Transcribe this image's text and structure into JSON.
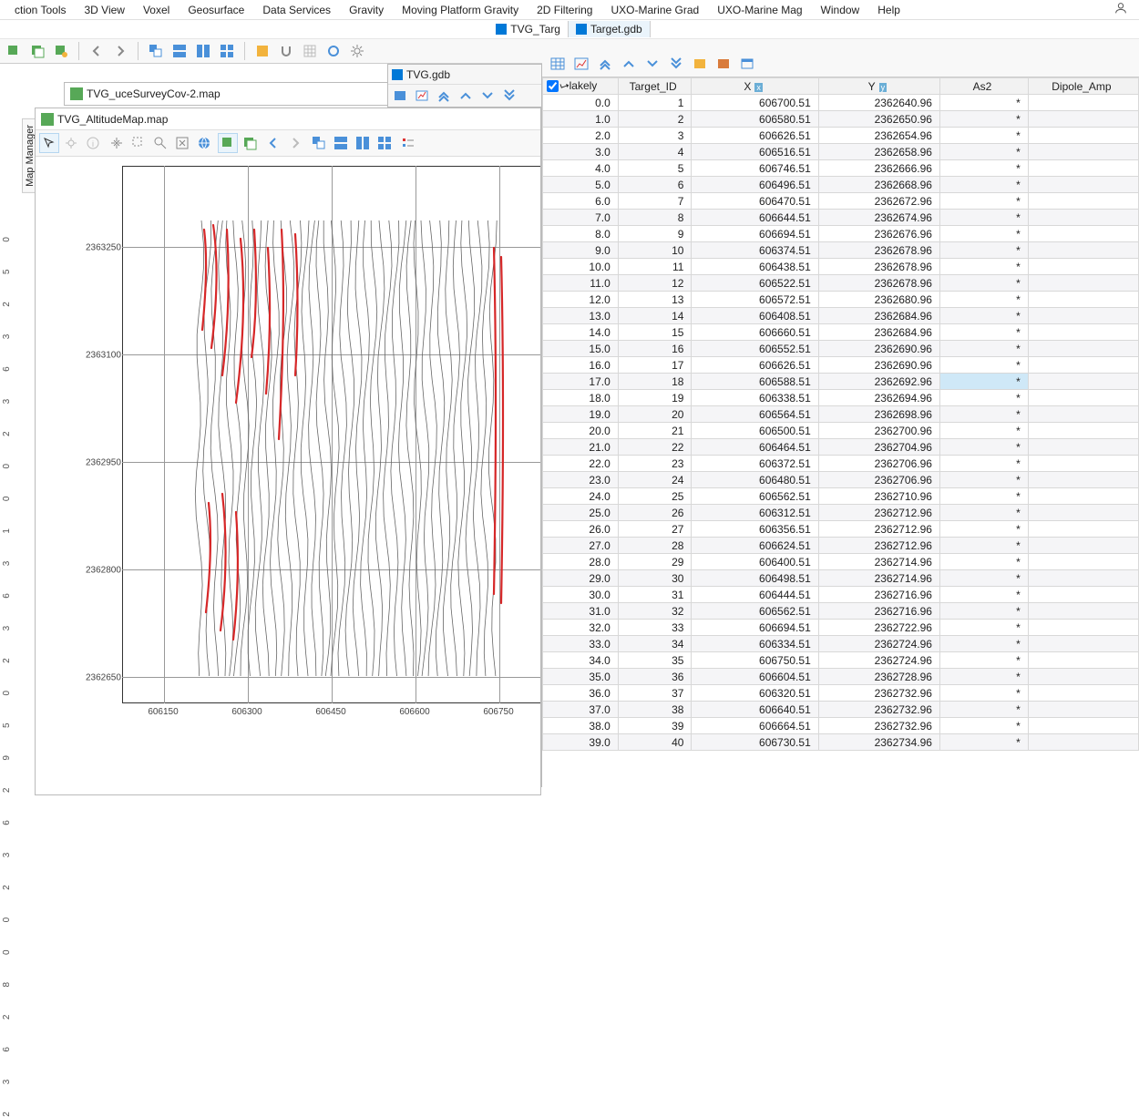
{
  "menu": [
    "ction Tools",
    "3D View",
    "Voxel",
    "Geosurface",
    "Data Services",
    "Gravity",
    "Moving Platform Gravity",
    "2D Filtering",
    "UXO-Marine Grad",
    "UXO-Marine Mag",
    "Window",
    "Help"
  ],
  "doc_tabs": {
    "left": "TVG_Targ",
    "right": "Target.gdb"
  },
  "map_tabs": {
    "background": "TVG_uceSurveyCov-2.map",
    "active": "TVG_AltitudeMap.map"
  },
  "side_panel_label": "Map Manager",
  "float_window_title": "TVG.gdb",
  "left_outer_axis_ticks": [
    "2362800",
    "2362950",
    "2363100",
    "2363250"
  ],
  "table": {
    "headers": {
      "col1": "lakely",
      "col2": "Target_ID",
      "col3": "X",
      "col4": "Y",
      "col5": "As2",
      "col6": "Dipole_Amp"
    },
    "selected_row_index": 17,
    "rows": [
      {
        "c1": "0.0",
        "c2": "1",
        "c3": "606700.51",
        "c4": "2362640.96",
        "c5": "*",
        "c6": ""
      },
      {
        "c1": "1.0",
        "c2": "2",
        "c3": "606580.51",
        "c4": "2362650.96",
        "c5": "*",
        "c6": ""
      },
      {
        "c1": "2.0",
        "c2": "3",
        "c3": "606626.51",
        "c4": "2362654.96",
        "c5": "*",
        "c6": ""
      },
      {
        "c1": "3.0",
        "c2": "4",
        "c3": "606516.51",
        "c4": "2362658.96",
        "c5": "*",
        "c6": ""
      },
      {
        "c1": "4.0",
        "c2": "5",
        "c3": "606746.51",
        "c4": "2362666.96",
        "c5": "*",
        "c6": ""
      },
      {
        "c1": "5.0",
        "c2": "6",
        "c3": "606496.51",
        "c4": "2362668.96",
        "c5": "*",
        "c6": ""
      },
      {
        "c1": "6.0",
        "c2": "7",
        "c3": "606470.51",
        "c4": "2362672.96",
        "c5": "*",
        "c6": ""
      },
      {
        "c1": "7.0",
        "c2": "8",
        "c3": "606644.51",
        "c4": "2362674.96",
        "c5": "*",
        "c6": ""
      },
      {
        "c1": "8.0",
        "c2": "9",
        "c3": "606694.51",
        "c4": "2362676.96",
        "c5": "*",
        "c6": ""
      },
      {
        "c1": "9.0",
        "c2": "10",
        "c3": "606374.51",
        "c4": "2362678.96",
        "c5": "*",
        "c6": ""
      },
      {
        "c1": "10.0",
        "c2": "11",
        "c3": "606438.51",
        "c4": "2362678.96",
        "c5": "*",
        "c6": ""
      },
      {
        "c1": "11.0",
        "c2": "12",
        "c3": "606522.51",
        "c4": "2362678.96",
        "c5": "*",
        "c6": ""
      },
      {
        "c1": "12.0",
        "c2": "13",
        "c3": "606572.51",
        "c4": "2362680.96",
        "c5": "*",
        "c6": ""
      },
      {
        "c1": "13.0",
        "c2": "14",
        "c3": "606408.51",
        "c4": "2362684.96",
        "c5": "*",
        "c6": ""
      },
      {
        "c1": "14.0",
        "c2": "15",
        "c3": "606660.51",
        "c4": "2362684.96",
        "c5": "*",
        "c6": ""
      },
      {
        "c1": "15.0",
        "c2": "16",
        "c3": "606552.51",
        "c4": "2362690.96",
        "c5": "*",
        "c6": ""
      },
      {
        "c1": "16.0",
        "c2": "17",
        "c3": "606626.51",
        "c4": "2362690.96",
        "c5": "*",
        "c6": ""
      },
      {
        "c1": "17.0",
        "c2": "18",
        "c3": "606588.51",
        "c4": "2362692.96",
        "c5": "*",
        "c6": ""
      },
      {
        "c1": "18.0",
        "c2": "19",
        "c3": "606338.51",
        "c4": "2362694.96",
        "c5": "*",
        "c6": ""
      },
      {
        "c1": "19.0",
        "c2": "20",
        "c3": "606564.51",
        "c4": "2362698.96",
        "c5": "*",
        "c6": ""
      },
      {
        "c1": "20.0",
        "c2": "21",
        "c3": "606500.51",
        "c4": "2362700.96",
        "c5": "*",
        "c6": ""
      },
      {
        "c1": "21.0",
        "c2": "22",
        "c3": "606464.51",
        "c4": "2362704.96",
        "c5": "*",
        "c6": ""
      },
      {
        "c1": "22.0",
        "c2": "23",
        "c3": "606372.51",
        "c4": "2362706.96",
        "c5": "*",
        "c6": ""
      },
      {
        "c1": "23.0",
        "c2": "24",
        "c3": "606480.51",
        "c4": "2362706.96",
        "c5": "*",
        "c6": ""
      },
      {
        "c1": "24.0",
        "c2": "25",
        "c3": "606562.51",
        "c4": "2362710.96",
        "c5": "*",
        "c6": ""
      },
      {
        "c1": "25.0",
        "c2": "26",
        "c3": "606312.51",
        "c4": "2362712.96",
        "c5": "*",
        "c6": ""
      },
      {
        "c1": "26.0",
        "c2": "27",
        "c3": "606356.51",
        "c4": "2362712.96",
        "c5": "*",
        "c6": ""
      },
      {
        "c1": "27.0",
        "c2": "28",
        "c3": "606624.51",
        "c4": "2362712.96",
        "c5": "*",
        "c6": ""
      },
      {
        "c1": "28.0",
        "c2": "29",
        "c3": "606400.51",
        "c4": "2362714.96",
        "c5": "*",
        "c6": ""
      },
      {
        "c1": "29.0",
        "c2": "30",
        "c3": "606498.51",
        "c4": "2362714.96",
        "c5": "*",
        "c6": ""
      },
      {
        "c1": "30.0",
        "c2": "31",
        "c3": "606444.51",
        "c4": "2362716.96",
        "c5": "*",
        "c6": ""
      },
      {
        "c1": "31.0",
        "c2": "32",
        "c3": "606562.51",
        "c4": "2362716.96",
        "c5": "*",
        "c6": ""
      },
      {
        "c1": "32.0",
        "c2": "33",
        "c3": "606694.51",
        "c4": "2362722.96",
        "c5": "*",
        "c6": ""
      },
      {
        "c1": "33.0",
        "c2": "34",
        "c3": "606334.51",
        "c4": "2362724.96",
        "c5": "*",
        "c6": ""
      },
      {
        "c1": "34.0",
        "c2": "35",
        "c3": "606750.51",
        "c4": "2362724.96",
        "c5": "*",
        "c6": ""
      },
      {
        "c1": "35.0",
        "c2": "36",
        "c3": "606604.51",
        "c4": "2362728.96",
        "c5": "*",
        "c6": ""
      },
      {
        "c1": "36.0",
        "c2": "37",
        "c3": "606320.51",
        "c4": "2362732.96",
        "c5": "*",
        "c6": ""
      },
      {
        "c1": "37.0",
        "c2": "38",
        "c3": "606640.51",
        "c4": "2362732.96",
        "c5": "*",
        "c6": ""
      },
      {
        "c1": "38.0",
        "c2": "39",
        "c3": "606664.51",
        "c4": "2362732.96",
        "c5": "*",
        "c6": ""
      },
      {
        "c1": "39.0",
        "c2": "40",
        "c3": "606730.51",
        "c4": "2362734.96",
        "c5": "*",
        "c6": ""
      }
    ]
  },
  "chart_data": {
    "type": "line",
    "title": "",
    "xlabel": "",
    "ylabel": "",
    "x_ticks": [
      606150,
      606300,
      606450,
      606600,
      606750
    ],
    "y_ticks": [
      2362650,
      2362800,
      2362950,
      2363100,
      2363250
    ],
    "xlim": [
      606075,
      606825
    ],
    "ylim": [
      2362575,
      2363325
    ],
    "description": "Parallel N-S survey lines (~40) between x≈606210 and x≈606760 spanning y≈2362620 to y≈2363280; many lines with red anomaly segments concentrated near x≈606220-606380 (upper-left quarter) and around x≈606730-606760 (right edge)."
  }
}
